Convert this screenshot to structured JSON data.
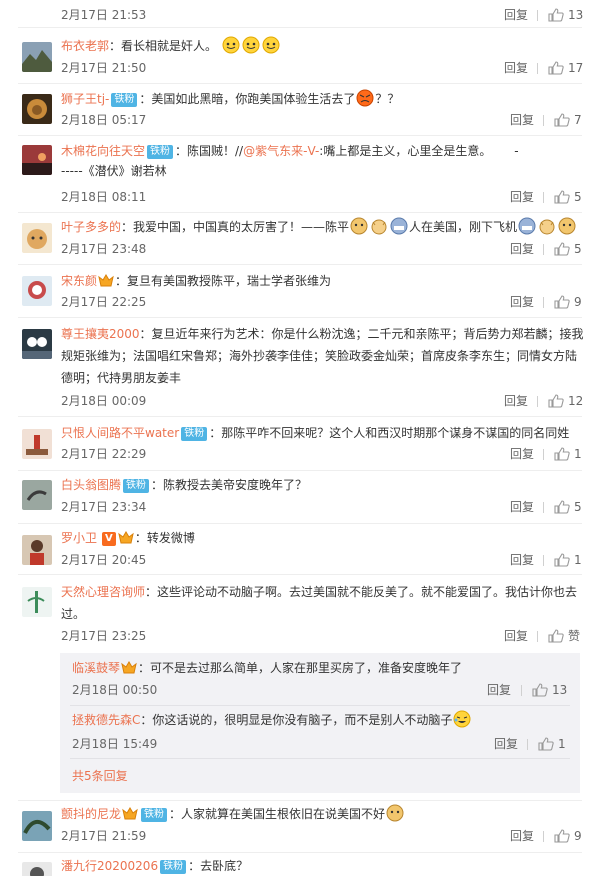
{
  "ui": {
    "reply_label": "回复",
    "more_replies_label": "共5条回复"
  },
  "comments": [
    {
      "time": "2月17日 21:53",
      "likes": "13"
    },
    {
      "user": "布衣老郭",
      "text": "：看长相就是奸人。",
      "time": "2月17日 21:50",
      "likes": "17"
    },
    {
      "user": "狮子王tj-",
      "badge": "铁粉",
      "text": "：美国如此黑暗，你跑美国体验生活去了",
      "text_after": "？？",
      "time": "2月18日 05:17",
      "likes": "7"
    },
    {
      "user": "木棉花向往天空",
      "badge": "铁粉",
      "text_before": "：陈国贼！//",
      "mention": "@紫气东来-V-",
      "text": ":嘴上都是主义，心里全是生意。      ------《潜伏》谢若林",
      "time": "2月18日 08:11",
      "likes": "5"
    },
    {
      "user": "叶子多多的",
      "text": "：我爱中国，中国真的太厉害了！——陈平",
      "text_mid": "人在美国，刚下飞机",
      "time": "2月17日 23:48",
      "likes": "5"
    },
    {
      "user": "宋东颜",
      "text": "：复旦有美国教授陈平，瑞士学者张维为",
      "time": "2月17日 22:25",
      "likes": "9"
    },
    {
      "user": "尊王攘夷2000",
      "text": "：复旦近年来行为艺术：你是什么粉沈逸；二千元和亲陈平；背后势力郑若麟；接我规矩张维为；法国唱红宋鲁郑；海外抄袭李佳佳；笑脸政委金灿荣；首席皮条李东生；同情女方陆德明；代持男朋友姜丰",
      "time": "2月18日 00:09",
      "likes": "12"
    },
    {
      "user": "只恨人间路不平water",
      "badge": "铁粉",
      "text": "：那陈平咋不回来呢？这个人和西汉时期那个谋身不谋国的同名同姓",
      "time": "2月17日 22:29",
      "likes": "1"
    },
    {
      "user": "白头翁图腾",
      "badge": "铁粉",
      "text": "：陈教授去美帝安度晚年了？",
      "time": "2月17日 23:34",
      "likes": "5"
    },
    {
      "user": "罗小卫",
      "text": "：转发微博",
      "time": "2月17日 20:45",
      "likes": "1"
    },
    {
      "user": "天然心理咨询师",
      "text": "：这些评论动不动脑子啊。去过美国就不能反美了。就不能爱国了。我估计你也去过。",
      "time": "2月17日 23:25",
      "likes": "赞"
    },
    {
      "user": "颤抖的尼龙",
      "badge": "铁粉",
      "text": "：人家就算在美国生根依旧在说美国不好",
      "time": "2月17日 21:59",
      "likes": "9"
    },
    {
      "user": "潘九行20200206",
      "badge": "铁粉",
      "text": "：去卧底？"
    }
  ],
  "sub_replies": [
    {
      "user": "临溪鼓琴",
      "text": "：可不是去过那么简单，人家在那里买房了，准备安度晚年了",
      "time": "2月18日 00:50",
      "likes": "13"
    },
    {
      "user": "拯救德先森C",
      "text": "：你这话说的，很明显是你没有脑子，而不是别人不动脑子",
      "time": "2月18日 15:49",
      "likes": "1"
    }
  ]
}
